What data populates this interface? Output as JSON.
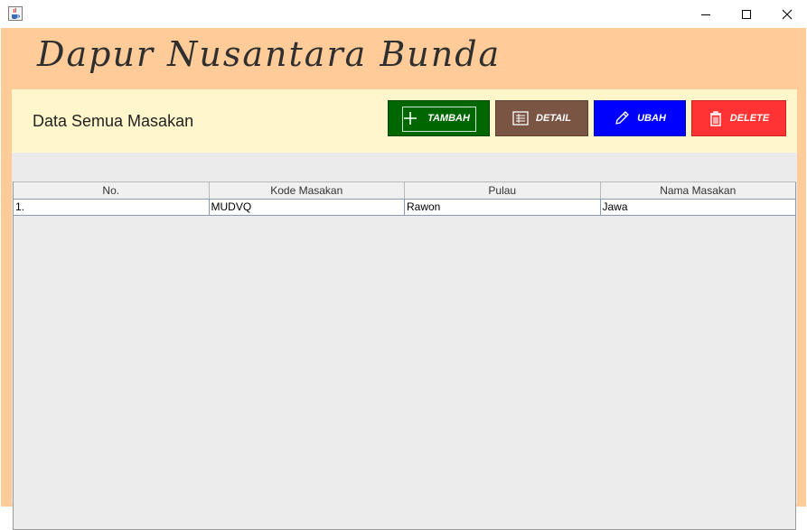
{
  "window": {
    "icon": "java-cup-icon",
    "controls": [
      "minimize-icon",
      "maximize-icon",
      "close-icon"
    ]
  },
  "brand": {
    "title": "Dapur Nusantara Bunda"
  },
  "toolbar": {
    "section_title": "Data Semua Masakan",
    "buttons": [
      {
        "label": "TAMBAH",
        "icon": "plus-icon",
        "color": "#006600"
      },
      {
        "label": "DETAIL",
        "icon": "list-icon",
        "color": "#7a5544"
      },
      {
        "label": "UBAH",
        "icon": "pencil-icon",
        "color": "#0000ff"
      },
      {
        "label": "DELETE",
        "icon": "trash-icon",
        "color": "#ff3333"
      }
    ]
  },
  "table": {
    "columns": [
      "No.",
      "Kode Masakan",
      "Pulau",
      "Nama Masakan"
    ],
    "rows": [
      [
        "1.",
        "MUDVQ",
        "Rawon",
        "Jawa"
      ]
    ]
  },
  "colors": {
    "frame_bg": "#ffcc99",
    "toolbar_bg": "#fff6cc",
    "table_bg": "#ececec"
  }
}
